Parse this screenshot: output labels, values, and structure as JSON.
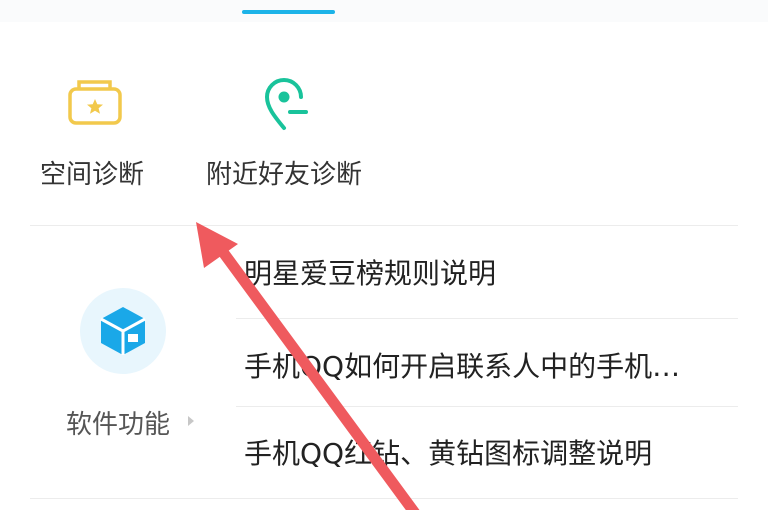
{
  "tools": [
    {
      "label": "空间诊断",
      "icon": "space-diagnosis-icon"
    },
    {
      "label": "附近好友诊断",
      "icon": "nearby-friends-location-icon"
    }
  ],
  "category": {
    "label": "软件功能",
    "icon": "software-feature-cube-icon"
  },
  "faq": [
    {
      "label": "明星爱豆榜规则说明"
    },
    {
      "label": "手机QQ如何开启联系人中的手机…"
    },
    {
      "label": "手机QQ红钻、黄钻图标调整说明"
    }
  ],
  "colors": {
    "accent": "#1cb3e8",
    "space_icon": "#f2c94c",
    "nearby_icon": "#19c39b",
    "annotation_arrow": "#ef5a5e"
  }
}
